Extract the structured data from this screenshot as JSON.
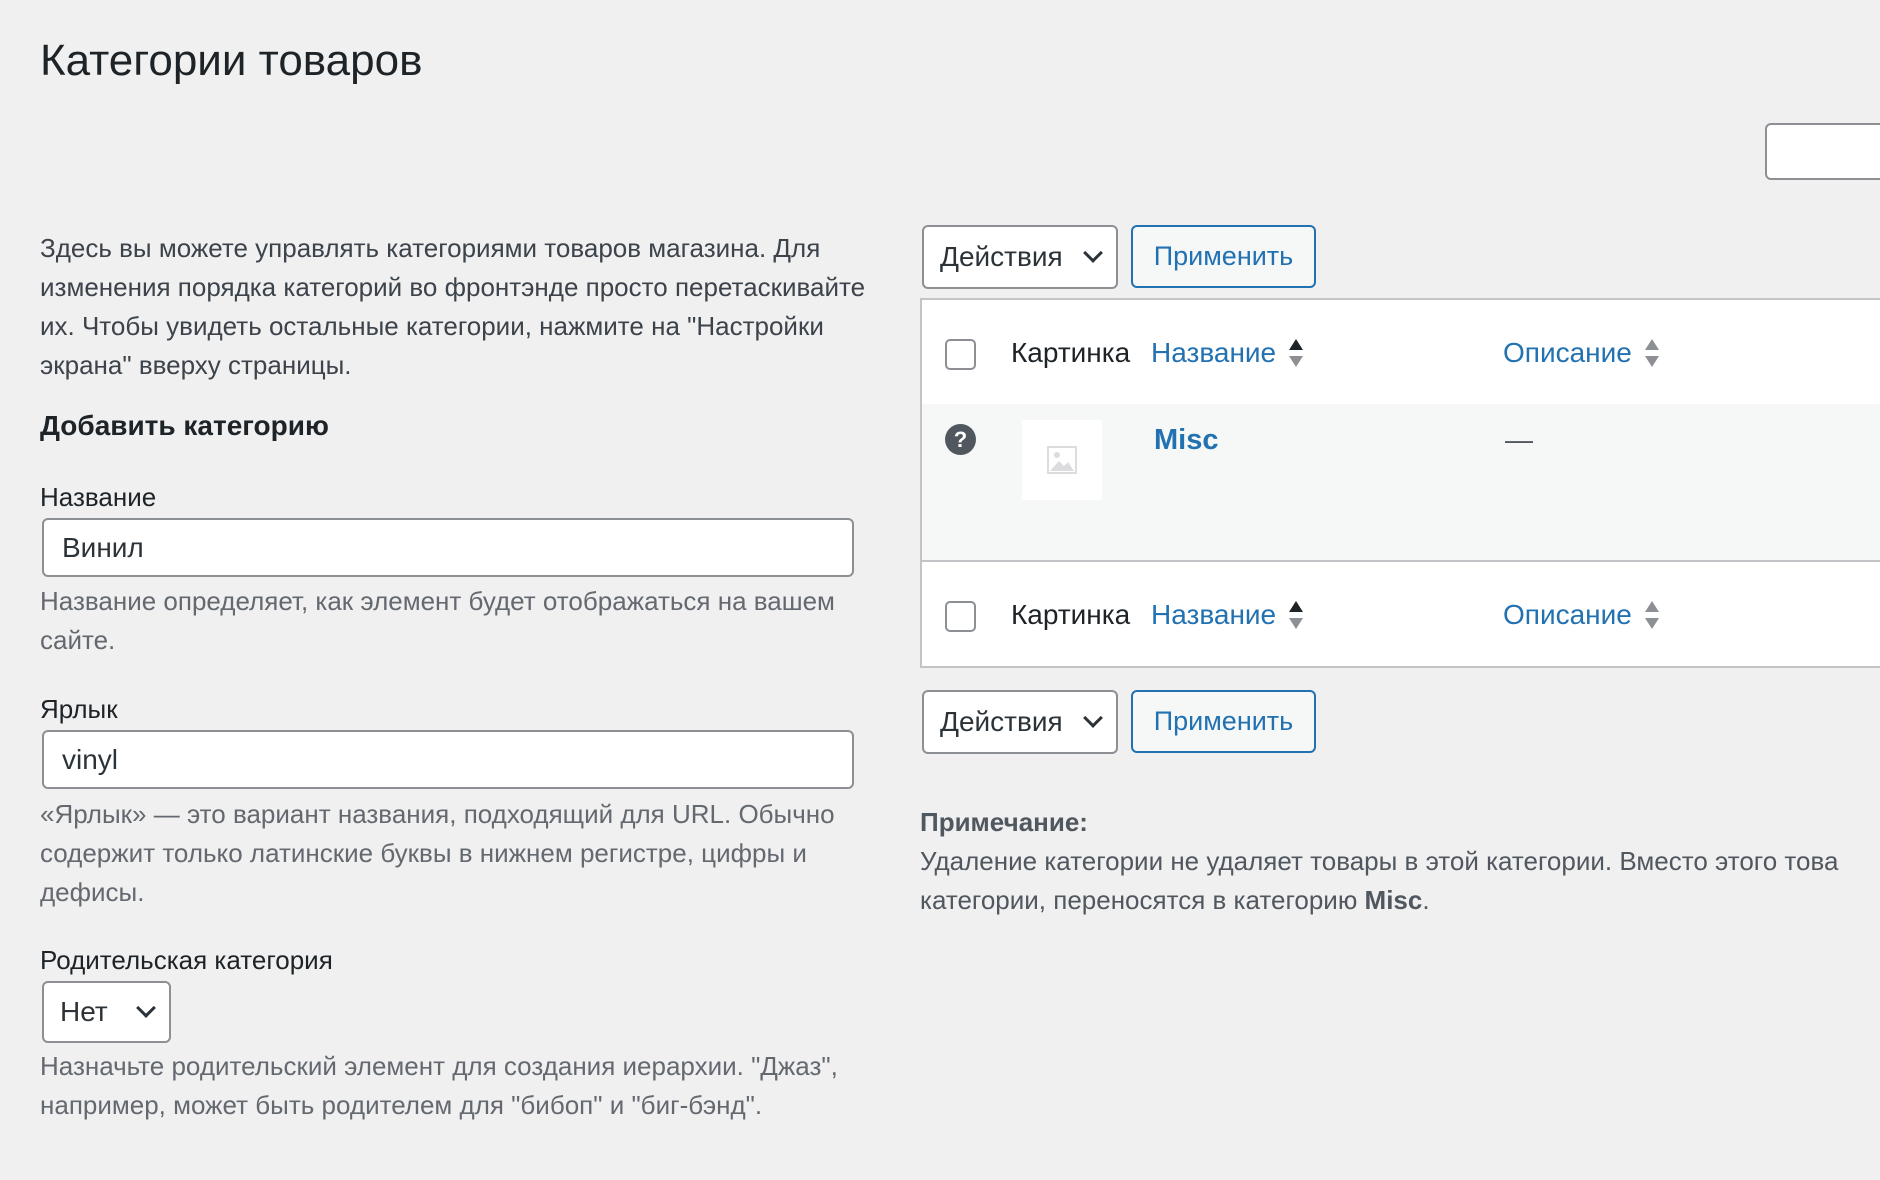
{
  "page": {
    "title": "Категории товаров"
  },
  "intro": "Здесь вы можете управлять категориями товаров магазина. Для изменения порядка категорий во фронтэнде просто перетаскивайте их. Чтобы увидеть остальные категории, нажмите на \"Настройки экрана\" вверху страницы.",
  "form": {
    "heading": "Добавить категорию",
    "name": {
      "label": "Название",
      "value": "Винил",
      "hint": "Название определяет, как элемент будет отображаться на вашем сайте."
    },
    "slug": {
      "label": "Ярлык",
      "value": "vinyl",
      "hint": "«Ярлык» — это вариант названия, подходящий для URL. Обычно содержит только латинские буквы в нижнем регистре, цифры и дефисы."
    },
    "parent": {
      "label": "Родительская категория",
      "value": "Нет",
      "hint": "Назначьте родительский элемент для создания иерархии. \"Джаз\", например, может быть родителем для \"бибоп\" и \"биг-бэнд\"."
    }
  },
  "bulk": {
    "actions_label": "Действия",
    "apply_label": "Применить"
  },
  "table": {
    "columns": {
      "image": "Картинка",
      "name": "Название",
      "description": "Описание"
    },
    "rows": [
      {
        "name": "Misc",
        "description": "—"
      }
    ]
  },
  "note": {
    "title": "Примечание:",
    "text_1": "Удаление категории не удаляет товары в этой категории. Вместо этого това",
    "text_2": "категории, переносятся в категорию ",
    "text_2_bold": "Misc",
    "text_2_end": "."
  },
  "colors": {
    "link": "#2271b1",
    "background": "#f0f0f1"
  }
}
